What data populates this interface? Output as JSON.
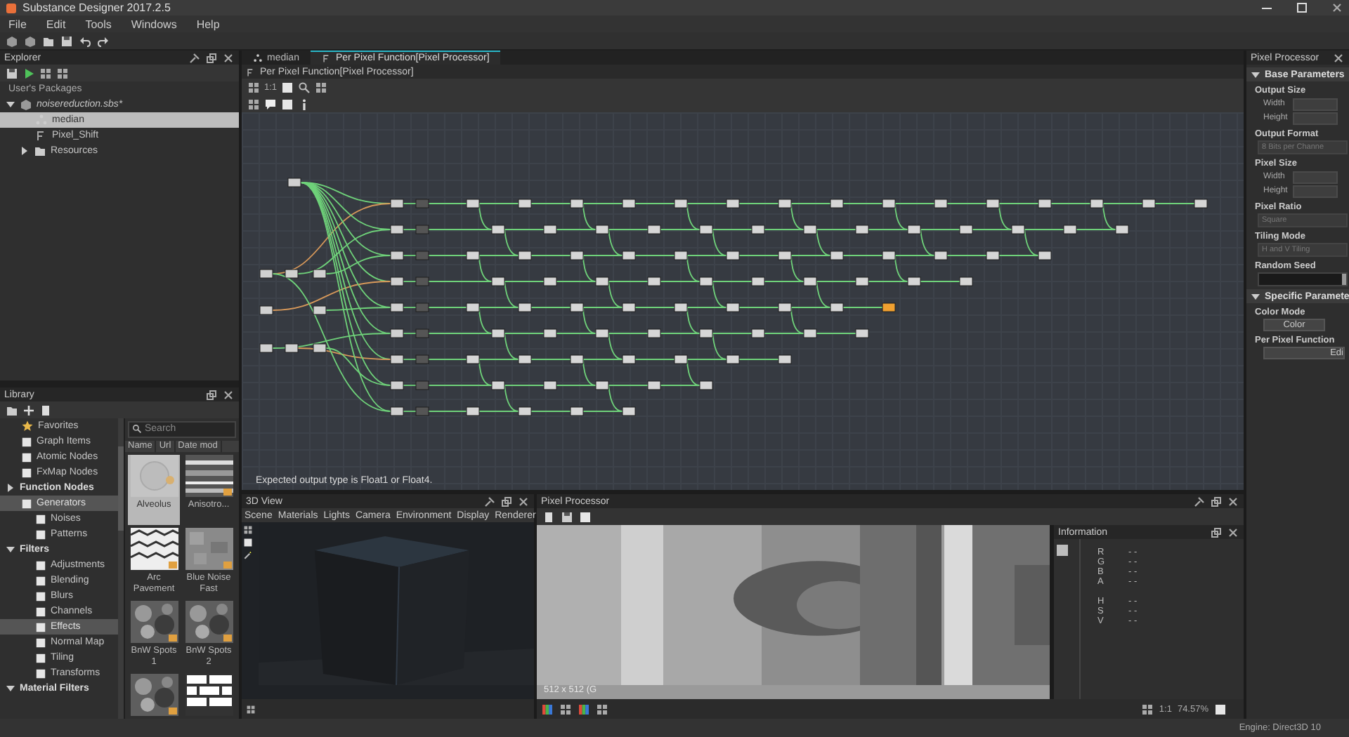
{
  "window": {
    "title": "Substance Designer 2017.2.5"
  },
  "menu": [
    "File",
    "Edit",
    "Tools",
    "Windows",
    "Help"
  ],
  "explorer": {
    "title": "Explorer",
    "section": "User's Packages",
    "tree": [
      {
        "label": "noisereduction.sbs*",
        "kind": "package",
        "expanded": true,
        "selected": false,
        "children": [
          {
            "label": "median",
            "kind": "graph",
            "selected": true
          },
          {
            "label": "Pixel_Shift",
            "kind": "function",
            "selected": false
          },
          {
            "label": "Resources",
            "kind": "folder",
            "expanded": false,
            "selected": false
          }
        ]
      }
    ]
  },
  "library": {
    "title": "Library",
    "search": {
      "placeholder": "Search"
    },
    "columns": [
      "Name",
      "Url",
      "Date mod"
    ],
    "categories": [
      {
        "label": "Favorites",
        "kind": "item",
        "selected": false
      },
      {
        "label": "Graph Items",
        "kind": "item",
        "selected": false
      },
      {
        "label": "Atomic Nodes",
        "kind": "item",
        "selected": false
      },
      {
        "label": "FxMap Nodes",
        "kind": "item",
        "selected": false
      },
      {
        "label": "Function Nodes",
        "kind": "section",
        "expanded": false,
        "selected": false
      },
      {
        "label": "Generators",
        "kind": "item",
        "selected": true,
        "children": [
          {
            "label": "Noises",
            "kind": "item",
            "selected": false
          },
          {
            "label": "Patterns",
            "kind": "item",
            "selected": false
          }
        ]
      },
      {
        "label": "Filters",
        "kind": "section",
        "expanded": true,
        "selected": false,
        "children": [
          {
            "label": "Adjustments",
            "kind": "item",
            "selected": false
          },
          {
            "label": "Blending",
            "kind": "item",
            "selected": false
          },
          {
            "label": "Blurs",
            "kind": "item",
            "selected": false
          },
          {
            "label": "Channels",
            "kind": "item",
            "selected": false
          },
          {
            "label": "Effects",
            "kind": "item",
            "selected": true
          },
          {
            "label": "Normal Map",
            "kind": "item",
            "selected": false
          },
          {
            "label": "Tiling",
            "kind": "item",
            "selected": false
          },
          {
            "label": "Transforms",
            "kind": "item",
            "selected": false
          }
        ]
      },
      {
        "label": "Material Filters",
        "kind": "section",
        "expanded": true,
        "selected": false
      }
    ],
    "thumbnails": [
      {
        "label": "Alveolus",
        "selected": true
      },
      {
        "label": "Anisotro...",
        "selected": false
      },
      {
        "label": "Arc Pavement",
        "selected": false
      },
      {
        "label": "Blue Noise Fast",
        "selected": false
      },
      {
        "label": "BnW Spots 1",
        "selected": false
      },
      {
        "label": "BnW Spots 2",
        "selected": false
      },
      {
        "selected": false
      },
      {
        "selected": false
      }
    ]
  },
  "graph": {
    "tabs": [
      {
        "label": "median",
        "selected": false
      },
      {
        "label": "Per Pixel Function[Pixel Processor]",
        "selected": true
      }
    ],
    "breadcrumb": "Per Pixel Function[Pixel Processor]",
    "zoom_label": "1:1",
    "message": "Expected output type is Float1 or Float4."
  },
  "view3d": {
    "title": "3D View",
    "menu": [
      "Scene",
      "Materials",
      "Lights",
      "Camera",
      "Environment",
      "Display",
      "Renderer"
    ]
  },
  "pixel_view": {
    "title": "Pixel Processor",
    "overlay": "512 x 512 (G",
    "zoom_label": "1:1",
    "zoom_percent": "74.57%"
  },
  "information": {
    "title": "Information",
    "rgba": [
      {
        "label": "R",
        "value": "- -"
      },
      {
        "label": "G",
        "value": "- -"
      },
      {
        "label": "B",
        "value": "- -"
      },
      {
        "label": "A",
        "value": "- -"
      }
    ],
    "hsv": [
      {
        "label": "H",
        "value": "- -"
      },
      {
        "label": "S",
        "value": "- -"
      },
      {
        "label": "V",
        "value": "- -"
      }
    ]
  },
  "parameters": {
    "title": "Pixel Processor",
    "sections": [
      {
        "title": "Base Parameters",
        "expanded": true,
        "groups": [
          {
            "kind": "pair",
            "label": "Output Size",
            "fields": [
              "Width",
              "Height"
            ]
          },
          {
            "kind": "dropdown",
            "label": "Output Format",
            "value": "8 Bits per Channe"
          },
          {
            "kind": "pair",
            "label": "Pixel Size",
            "fields": [
              "Width",
              "Height"
            ]
          },
          {
            "kind": "dropdown",
            "label": "Pixel Ratio",
            "value": "Square"
          },
          {
            "kind": "dropdown",
            "label": "Tiling Mode",
            "value": "H and V Tiling"
          },
          {
            "kind": "slider",
            "label": "Random Seed"
          }
        ]
      },
      {
        "title": "Specific Paramete",
        "expanded": true,
        "groups": [
          {
            "kind": "button",
            "label": "Color Mode",
            "value": "Color"
          },
          {
            "kind": "button",
            "label": "Per Pixel Function",
            "value": "Edi"
          }
        ]
      }
    ]
  },
  "status_bar": {
    "engine": "Engine: Direct3D 10"
  }
}
